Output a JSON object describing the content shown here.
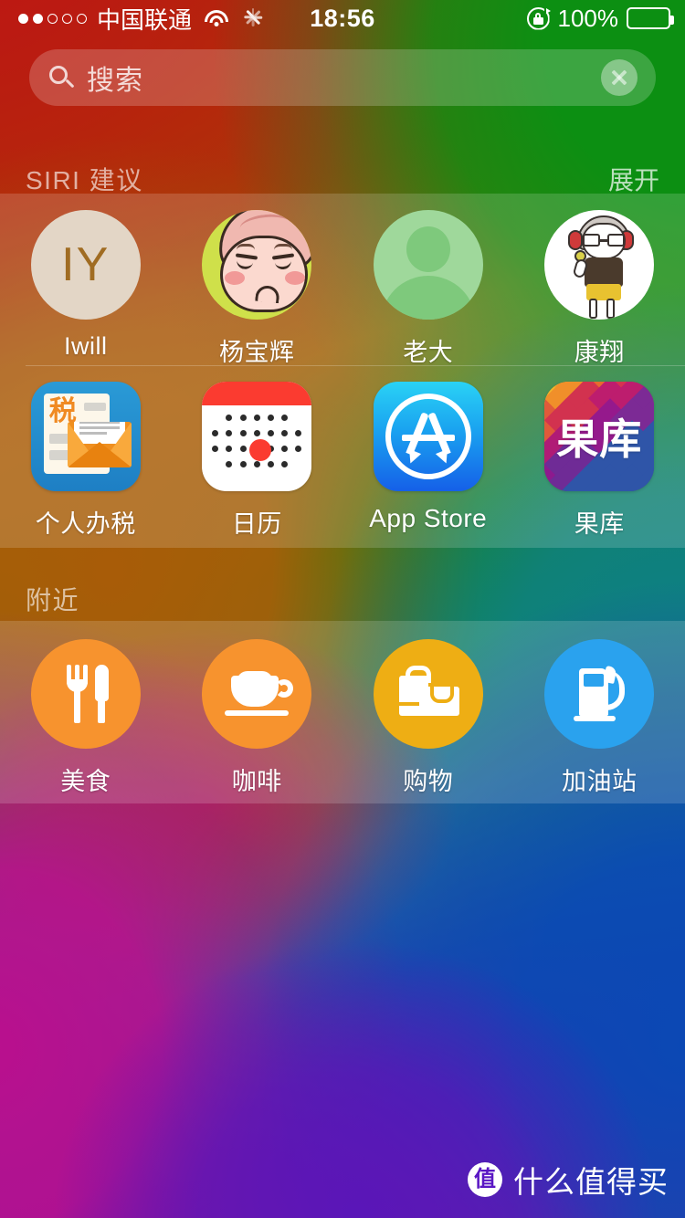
{
  "colors": {
    "accent_orange": "#f7932e",
    "accent_amber": "#eeae14",
    "accent_blue": "#2aa2ee",
    "calendar_red": "#fb3b30",
    "appstore_blue": "#1560e8",
    "tax_blue": "#1e7fc4",
    "panel_overlay": "rgba(255,255,255,0.16)",
    "watermark_purple": "#5a17c4"
  },
  "statusbar": {
    "signal_dots_total": 5,
    "signal_dots_filled": 2,
    "carrier": "中国联通",
    "wifi_icon": "wifi-icon",
    "activity_icon": "activity-spinner-icon",
    "time": "18:56",
    "rotation_lock_icon": "rotation-lock-icon",
    "battery_percent": "100%",
    "battery_icon": "battery-full-icon"
  },
  "search": {
    "icon": "search-icon",
    "placeholder": "搜索",
    "value": "",
    "clear_icon": "clear-circle-icon"
  },
  "sections": [
    {
      "id": "siri-suggestions",
      "title": "SIRI 建议",
      "action_label": "展开"
    },
    {
      "id": "nearby",
      "title": "附近",
      "action_label": ""
    }
  ],
  "siri_contacts": [
    {
      "label": "Iwill",
      "avatar": "avatar-initials",
      "initials": "IY"
    },
    {
      "label": "杨宝辉",
      "avatar": "avatar-cartoon-pink-hat"
    },
    {
      "label": "老大",
      "avatar": "avatar-default-silhouette"
    },
    {
      "label": "康翔",
      "avatar": "avatar-cartoon-glasses"
    }
  ],
  "siri_apps": [
    {
      "label": "个人办税",
      "icon": "app-icon-tax",
      "badge_char": "税"
    },
    {
      "label": "日历",
      "icon": "app-icon-calendar"
    },
    {
      "label": "App Store",
      "icon": "app-icon-app-store"
    },
    {
      "label": "果库",
      "icon": "app-icon-guoku",
      "icon_text": "果库"
    }
  ],
  "nearby_items": [
    {
      "label": "美食",
      "icon": "food-icon",
      "color": "#f7932e"
    },
    {
      "label": "咖啡",
      "icon": "coffee-icon",
      "color": "#f7932e"
    },
    {
      "label": "购物",
      "icon": "shopping-icon",
      "color": "#eeae14"
    },
    {
      "label": "加油站",
      "icon": "gas-station-icon",
      "color": "#2aa2ee"
    }
  ],
  "watermark": {
    "badge_char": "值",
    "text": "什么值得买"
  }
}
